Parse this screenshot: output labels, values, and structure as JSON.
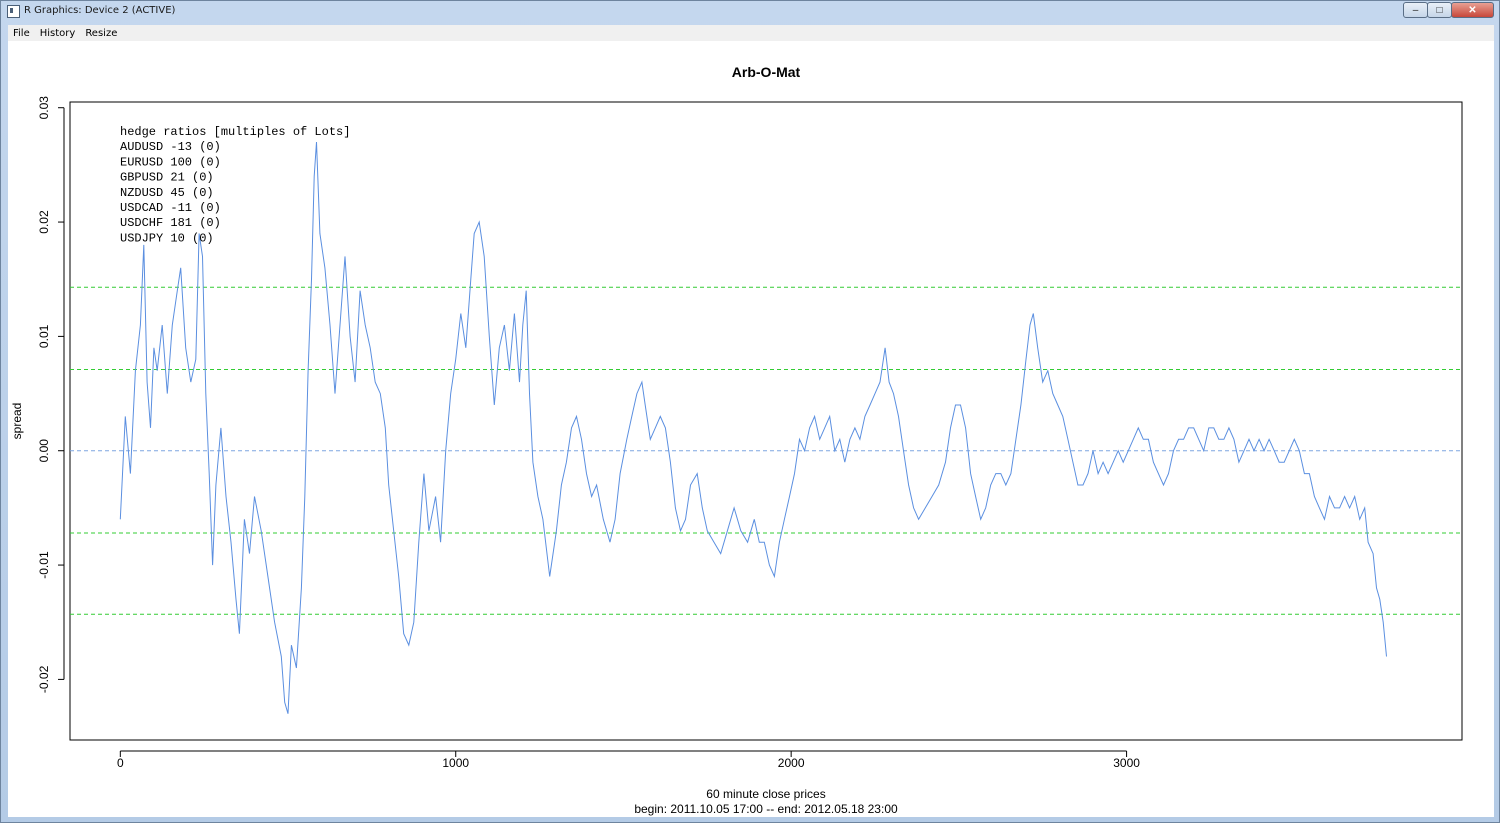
{
  "window": {
    "title": "R Graphics: Device 2 (ACTIVE)",
    "minimize_glyph": "–",
    "maximize_glyph": "□",
    "close_glyph": "✕"
  },
  "menu": {
    "items": [
      {
        "label": "File"
      },
      {
        "label": "History"
      },
      {
        "label": "Resize"
      }
    ]
  },
  "colors": {
    "series": "#5b8fe0",
    "band_outer": "#33cc33",
    "band_inner": "#33cc33",
    "zero_line": "#7ea6e0"
  },
  "chart_data": {
    "type": "line",
    "title": "Arb-O-Mat",
    "xlabel": "60 minute close prices",
    "xlabel_sub": "begin: 2011.10.05 17:00 -- end: 2012.05.18 23:00",
    "ylabel": "spread",
    "xlim": [
      -150,
      4000
    ],
    "ylim": [
      -0.0253,
      0.0305
    ],
    "xticks": [
      0,
      1000,
      2000,
      3000
    ],
    "xtick_labels": [
      "0",
      "1000",
      "2000",
      "3000"
    ],
    "yticks": [
      -0.02,
      -0.01,
      0.0,
      0.01,
      0.02,
      0.03
    ],
    "ytick_labels": [
      "-0.02",
      "-0.01",
      "0.00",
      "0.01",
      "0.02",
      "0.03"
    ],
    "hlines": [
      {
        "y": 0.0143,
        "style": "dashed",
        "color": "green"
      },
      {
        "y": 0.0071,
        "style": "dashed",
        "color": "green"
      },
      {
        "y": 0.0,
        "style": "dashed",
        "color": "blue"
      },
      {
        "y": -0.0072,
        "style": "dashed",
        "color": "green"
      },
      {
        "y": -0.0143,
        "style": "dashed",
        "color": "green"
      }
    ],
    "legend": {
      "placement": "top-left",
      "lines": [
        "hedge ratios [multiples of Lots]",
        "AUDUSD -13 (0)",
        "EURUSD 100 (0)",
        "GBPUSD 21 (0)",
        "NZDUSD 45 (0)",
        "USDCAD -11 (0)",
        "USDCHF 181 (0)",
        "USDJPY 10 (0)"
      ]
    },
    "series": [
      {
        "points": [
          [
            0,
            -0.006
          ],
          [
            15,
            0.003
          ],
          [
            30,
            -0.002
          ],
          [
            45,
            0.007
          ],
          [
            60,
            0.011
          ],
          [
            70,
            0.018
          ],
          [
            80,
            0.006
          ],
          [
            90,
            0.002
          ],
          [
            100,
            0.009
          ],
          [
            110,
            0.007
          ],
          [
            125,
            0.011
          ],
          [
            140,
            0.005
          ],
          [
            155,
            0.011
          ],
          [
            170,
            0.014
          ],
          [
            180,
            0.016
          ],
          [
            195,
            0.009
          ],
          [
            210,
            0.006
          ],
          [
            225,
            0.008
          ],
          [
            235,
            0.019
          ],
          [
            245,
            0.017
          ],
          [
            255,
            0.005
          ],
          [
            265,
            -0.002
          ],
          [
            275,
            -0.01
          ],
          [
            285,
            -0.003
          ],
          [
            300,
            0.002
          ],
          [
            315,
            -0.004
          ],
          [
            330,
            -0.008
          ],
          [
            345,
            -0.013
          ],
          [
            355,
            -0.016
          ],
          [
            370,
            -0.006
          ],
          [
            385,
            -0.009
          ],
          [
            400,
            -0.004
          ],
          [
            420,
            -0.007
          ],
          [
            440,
            -0.011
          ],
          [
            460,
            -0.015
          ],
          [
            480,
            -0.018
          ],
          [
            490,
            -0.022
          ],
          [
            500,
            -0.023
          ],
          [
            510,
            -0.017
          ],
          [
            525,
            -0.019
          ],
          [
            540,
            -0.012
          ],
          [
            550,
            -0.004
          ],
          [
            560,
            0.007
          ],
          [
            570,
            0.015
          ],
          [
            578,
            0.024
          ],
          [
            585,
            0.027
          ],
          [
            595,
            0.019
          ],
          [
            610,
            0.016
          ],
          [
            625,
            0.011
          ],
          [
            640,
            0.005
          ],
          [
            655,
            0.011
          ],
          [
            670,
            0.017
          ],
          [
            685,
            0.01
          ],
          [
            700,
            0.006
          ],
          [
            715,
            0.014
          ],
          [
            730,
            0.011
          ],
          [
            745,
            0.009
          ],
          [
            760,
            0.006
          ],
          [
            775,
            0.005
          ],
          [
            790,
            0.002
          ],
          [
            800,
            -0.003
          ],
          [
            815,
            -0.007
          ],
          [
            830,
            -0.011
          ],
          [
            845,
            -0.016
          ],
          [
            860,
            -0.017
          ],
          [
            875,
            -0.015
          ],
          [
            890,
            -0.008
          ],
          [
            905,
            -0.002
          ],
          [
            920,
            -0.007
          ],
          [
            940,
            -0.004
          ],
          [
            955,
            -0.008
          ],
          [
            970,
            0.0
          ],
          [
            985,
            0.005
          ],
          [
            1000,
            0.008
          ],
          [
            1015,
            0.012
          ],
          [
            1030,
            0.009
          ],
          [
            1045,
            0.015
          ],
          [
            1055,
            0.019
          ],
          [
            1070,
            0.02
          ],
          [
            1085,
            0.017
          ],
          [
            1100,
            0.01
          ],
          [
            1115,
            0.004
          ],
          [
            1130,
            0.009
          ],
          [
            1145,
            0.011
          ],
          [
            1160,
            0.007
          ],
          [
            1175,
            0.012
          ],
          [
            1190,
            0.006
          ],
          [
            1200,
            0.011
          ],
          [
            1210,
            0.014
          ],
          [
            1220,
            0.005
          ],
          [
            1230,
            -0.001
          ],
          [
            1245,
            -0.004
          ],
          [
            1260,
            -0.006
          ],
          [
            1280,
            -0.011
          ],
          [
            1300,
            -0.007
          ],
          [
            1315,
            -0.003
          ],
          [
            1330,
            -0.001
          ],
          [
            1345,
            0.002
          ],
          [
            1360,
            0.003
          ],
          [
            1375,
            0.001
          ],
          [
            1390,
            -0.002
          ],
          [
            1405,
            -0.004
          ],
          [
            1420,
            -0.003
          ],
          [
            1440,
            -0.006
          ],
          [
            1460,
            -0.008
          ],
          [
            1475,
            -0.006
          ],
          [
            1490,
            -0.002
          ],
          [
            1510,
            0.001
          ],
          [
            1525,
            0.003
          ],
          [
            1540,
            0.005
          ],
          [
            1555,
            0.006
          ],
          [
            1565,
            0.004
          ],
          [
            1580,
            0.001
          ],
          [
            1595,
            0.002
          ],
          [
            1610,
            0.003
          ],
          [
            1625,
            0.002
          ],
          [
            1640,
            -0.001
          ],
          [
            1655,
            -0.005
          ],
          [
            1670,
            -0.007
          ],
          [
            1685,
            -0.006
          ],
          [
            1700,
            -0.003
          ],
          [
            1720,
            -0.002
          ],
          [
            1735,
            -0.005
          ],
          [
            1750,
            -0.007
          ],
          [
            1770,
            -0.008
          ],
          [
            1790,
            -0.009
          ],
          [
            1810,
            -0.007
          ],
          [
            1830,
            -0.005
          ],
          [
            1850,
            -0.007
          ],
          [
            1870,
            -0.008
          ],
          [
            1890,
            -0.006
          ],
          [
            1905,
            -0.008
          ],
          [
            1920,
            -0.008
          ],
          [
            1935,
            -0.01
          ],
          [
            1950,
            -0.011
          ],
          [
            1965,
            -0.008
          ],
          [
            1980,
            -0.006
          ],
          [
            1995,
            -0.004
          ],
          [
            2010,
            -0.002
          ],
          [
            2025,
            0.001
          ],
          [
            2040,
            0.0
          ],
          [
            2055,
            0.002
          ],
          [
            2070,
            0.003
          ],
          [
            2085,
            0.001
          ],
          [
            2100,
            0.002
          ],
          [
            2115,
            0.003
          ],
          [
            2130,
            0.0
          ],
          [
            2145,
            0.001
          ],
          [
            2160,
            -0.001
          ],
          [
            2175,
            0.001
          ],
          [
            2190,
            0.002
          ],
          [
            2205,
            0.001
          ],
          [
            2220,
            0.003
          ],
          [
            2235,
            0.004
          ],
          [
            2250,
            0.005
          ],
          [
            2265,
            0.006
          ],
          [
            2280,
            0.009
          ],
          [
            2292,
            0.006
          ],
          [
            2305,
            0.005
          ],
          [
            2320,
            0.003
          ],
          [
            2335,
            0.0
          ],
          [
            2350,
            -0.003
          ],
          [
            2365,
            -0.005
          ],
          [
            2380,
            -0.006
          ],
          [
            2400,
            -0.005
          ],
          [
            2420,
            -0.004
          ],
          [
            2440,
            -0.003
          ],
          [
            2460,
            -0.001
          ],
          [
            2475,
            0.002
          ],
          [
            2490,
            0.004
          ],
          [
            2505,
            0.004
          ],
          [
            2520,
            0.002
          ],
          [
            2535,
            -0.002
          ],
          [
            2550,
            -0.004
          ],
          [
            2565,
            -0.006
          ],
          [
            2580,
            -0.005
          ],
          [
            2595,
            -0.003
          ],
          [
            2610,
            -0.002
          ],
          [
            2625,
            -0.002
          ],
          [
            2640,
            -0.003
          ],
          [
            2655,
            -0.002
          ],
          [
            2670,
            0.001
          ],
          [
            2685,
            0.004
          ],
          [
            2700,
            0.008
          ],
          [
            2712,
            0.011
          ],
          [
            2722,
            0.012
          ],
          [
            2735,
            0.009
          ],
          [
            2750,
            0.006
          ],
          [
            2765,
            0.007
          ],
          [
            2780,
            0.005
          ],
          [
            2795,
            0.004
          ],
          [
            2810,
            0.003
          ],
          [
            2825,
            0.001
          ],
          [
            2840,
            -0.001
          ],
          [
            2855,
            -0.003
          ],
          [
            2870,
            -0.003
          ],
          [
            2885,
            -0.002
          ],
          [
            2900,
            0.0
          ],
          [
            2915,
            -0.002
          ],
          [
            2930,
            -0.001
          ],
          [
            2945,
            -0.002
          ],
          [
            2960,
            -0.001
          ],
          [
            2975,
            0.0
          ],
          [
            2990,
            -0.001
          ],
          [
            3005,
            0.0
          ],
          [
            3020,
            0.001
          ],
          [
            3035,
            0.002
          ],
          [
            3050,
            0.001
          ],
          [
            3065,
            0.001
          ],
          [
            3080,
            -0.001
          ],
          [
            3095,
            -0.002
          ],
          [
            3110,
            -0.003
          ],
          [
            3125,
            -0.002
          ],
          [
            3140,
            0.0
          ],
          [
            3155,
            0.001
          ],
          [
            3170,
            0.001
          ],
          [
            3185,
            0.002
          ],
          [
            3200,
            0.002
          ],
          [
            3215,
            0.001
          ],
          [
            3230,
            0.0
          ],
          [
            3245,
            0.002
          ],
          [
            3260,
            0.002
          ],
          [
            3275,
            0.001
          ],
          [
            3290,
            0.001
          ],
          [
            3305,
            0.002
          ],
          [
            3320,
            0.001
          ],
          [
            3335,
            -0.001
          ],
          [
            3350,
            0.0
          ],
          [
            3365,
            0.001
          ],
          [
            3380,
            0.0
          ],
          [
            3395,
            0.001
          ],
          [
            3410,
            0.0
          ],
          [
            3425,
            0.001
          ],
          [
            3440,
            0.0
          ],
          [
            3455,
            -0.001
          ],
          [
            3470,
            -0.001
          ],
          [
            3485,
            0.0
          ],
          [
            3500,
            0.001
          ],
          [
            3515,
            0.0
          ],
          [
            3530,
            -0.002
          ],
          [
            3545,
            -0.002
          ],
          [
            3560,
            -0.004
          ],
          [
            3575,
            -0.005
          ],
          [
            3590,
            -0.006
          ],
          [
            3605,
            -0.004
          ],
          [
            3620,
            -0.005
          ],
          [
            3635,
            -0.005
          ],
          [
            3650,
            -0.004
          ],
          [
            3665,
            -0.005
          ],
          [
            3680,
            -0.004
          ],
          [
            3695,
            -0.006
          ],
          [
            3710,
            -0.005
          ],
          [
            3720,
            -0.008
          ],
          [
            3735,
            -0.009
          ],
          [
            3745,
            -0.012
          ],
          [
            3755,
            -0.013
          ],
          [
            3765,
            -0.015
          ],
          [
            3775,
            -0.018
          ]
        ]
      }
    ]
  }
}
